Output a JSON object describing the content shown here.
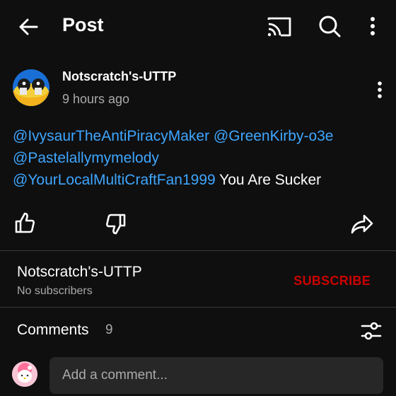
{
  "header": {
    "title": "Post",
    "icons": [
      "back-arrow-icon",
      "cast-icon",
      "search-icon",
      "more-vert-icon"
    ]
  },
  "post": {
    "author": "Notscratch's-UTTP",
    "timestamp": "9 hours ago",
    "mentions": [
      "@IvysaurTheAntiPiracyMaker",
      "@GreenKirby-o3e",
      "@Pastelallymymelody",
      "@YourLocalMultiCraftFan1999"
    ],
    "text": "You Are Sucker",
    "action_icons": [
      "like-icon",
      "dislike-icon",
      "share-icon"
    ]
  },
  "channel": {
    "name": "Notscratch's-UTTP",
    "subscribers": "No subscribers",
    "subscribe_label": "SUBSCRIBE"
  },
  "comments": {
    "label": "Comments",
    "count": "9",
    "placeholder": "Add a comment..."
  },
  "colors": {
    "background": "#0f0f0f",
    "mention": "#3ea6ff",
    "subscribe": "#cc0000",
    "secondary_text": "#aaaaaa",
    "input_bg": "#272727"
  }
}
